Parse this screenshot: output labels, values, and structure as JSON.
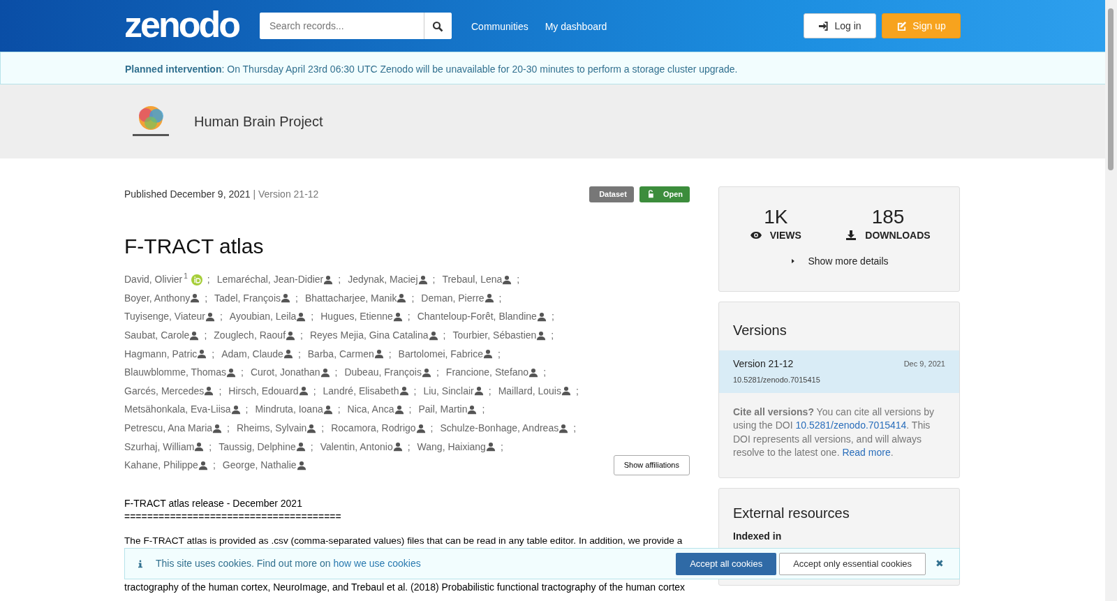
{
  "header": {
    "logo": "zenodo",
    "search": {
      "placeholder": "Search records..."
    },
    "nav": [
      "Communities",
      "My dashboard"
    ],
    "buttons": [
      {
        "kind": "login",
        "label": "Log in"
      },
      {
        "kind": "signup",
        "label": "Sign up"
      }
    ]
  },
  "announcement": {
    "title": "Planned intervention",
    "text": ": On Thursday April 23rd 06:30 UTC Zenodo will be unavailable for 20-30 minutes to perform a storage cluster upgrade."
  },
  "community": {
    "name": "Human Brain Project"
  },
  "record": {
    "published": "Published December 9, 2021",
    "version": "| Version 21-12",
    "badges": [
      {
        "kind": "type",
        "label": "Dataset"
      },
      {
        "kind": "access",
        "label": "Open"
      }
    ],
    "title": "F-TRACT atlas",
    "author_rows": [
      [
        {
          "name": "David, Olivier",
          "sup": "1",
          "orcid": true
        },
        {
          "name": "Lemaréchal, Jean-Didier"
        },
        {
          "name": "Jedynak, Maciej"
        },
        {
          "name": "Trebaul, Lena"
        }
      ],
      [
        {
          "name": "Boyer, Anthony"
        },
        {
          "name": "Tadel, François"
        },
        {
          "name": "Bhattacharjee, Manik"
        },
        {
          "name": "Deman, Pierre"
        }
      ],
      [
        {
          "name": "Tuyisenge, Viateur"
        },
        {
          "name": "Ayoubian, Leila"
        },
        {
          "name": "Hugues, Etienne"
        },
        {
          "name": "Chanteloup-Forêt, Blandine"
        }
      ],
      [
        {
          "name": "Saubat, Carole"
        },
        {
          "name": "Zouglech, Raouf"
        },
        {
          "name": "Reyes Mejia, Gina Catalina"
        },
        {
          "name": "Tourbier, Sébastien"
        }
      ],
      [
        {
          "name": "Hagmann, Patric"
        },
        {
          "name": "Adam, Claude"
        },
        {
          "name": "Barba, Carmen"
        },
        {
          "name": "Bartolomei, Fabrice"
        }
      ],
      [
        {
          "name": "Blauwblomme, Thomas"
        },
        {
          "name": "Curot, Jonathan"
        },
        {
          "name": "Dubeau, François"
        },
        {
          "name": "Francione, Stefano"
        }
      ],
      [
        {
          "name": "Garcés, Mercedes"
        },
        {
          "name": "Hirsch, Edouard"
        },
        {
          "name": "Landré, Elisabeth"
        },
        {
          "name": "Liu, Sinclair"
        },
        {
          "name": "Maillard, Louis"
        }
      ],
      [
        {
          "name": "Metsähonkala, Eva-Liisa"
        },
        {
          "name": "Mindruta, Ioana"
        },
        {
          "name": "Nica, Anca"
        },
        {
          "name": "Pail, Martin"
        }
      ],
      [
        {
          "name": "Petrescu, Ana Maria"
        },
        {
          "name": "Rheims, Sylvain"
        },
        {
          "name": "Rocamora, Rodrigo"
        },
        {
          "name": "Schulze-Bonhage, Andreas"
        }
      ],
      [
        {
          "name": "Szurhaj, William"
        },
        {
          "name": "Taussig, Delphine"
        },
        {
          "name": "Valentin, Antonio"
        },
        {
          "name": "Wang, Haixiang"
        }
      ],
      [
        {
          "name": "Kahane, Philippe"
        },
        {
          "name": "George, Nathalie"
        }
      ]
    ],
    "separator": ";",
    "affiliations_button": "Show affiliations",
    "description": [
      "F-TRACT atlas release - December 2021",
      "======================================"
    ],
    "paragraph": "The F-TRACT atlas is provided as .csv (comma-separated values) files that can be read in any table editor. In addition, we provide a",
    "paragraph_partial": "tractography of the human cortex, NeuroImage, and Trebaul et al. (2018) Probabilistic functional tractography of the human cortex"
  },
  "stats": {
    "items": [
      {
        "kind": "views",
        "value": "1K",
        "label": "VIEWS"
      },
      {
        "kind": "downloads",
        "value": "185",
        "label": "DOWNLOADS"
      }
    ],
    "more": "Show more details"
  },
  "versions": {
    "title": "Versions",
    "items": [
      {
        "label": "Version 21-12",
        "date": "Dec 9, 2021",
        "doi": "10.5281/zenodo.7015415",
        "selected": true
      }
    ],
    "cite_bold": "Cite all versions?",
    "cite_1": " You can cite all versions by using the DOI ",
    "cite_doi": "10.5281/zenodo.7015414",
    "cite_2": ". This DOI represents all versions, and will always resolve to the latest one. ",
    "read_more": "Read more",
    "cite_end": "."
  },
  "external": {
    "title": "External resources",
    "indexed": "Indexed in"
  },
  "cookies": {
    "text": "This site uses cookies. Find out more on ",
    "link": "how we use cookies",
    "accept_all": "Accept all cookies",
    "accept_essential": "Accept only essential cookies",
    "close": "✖"
  }
}
